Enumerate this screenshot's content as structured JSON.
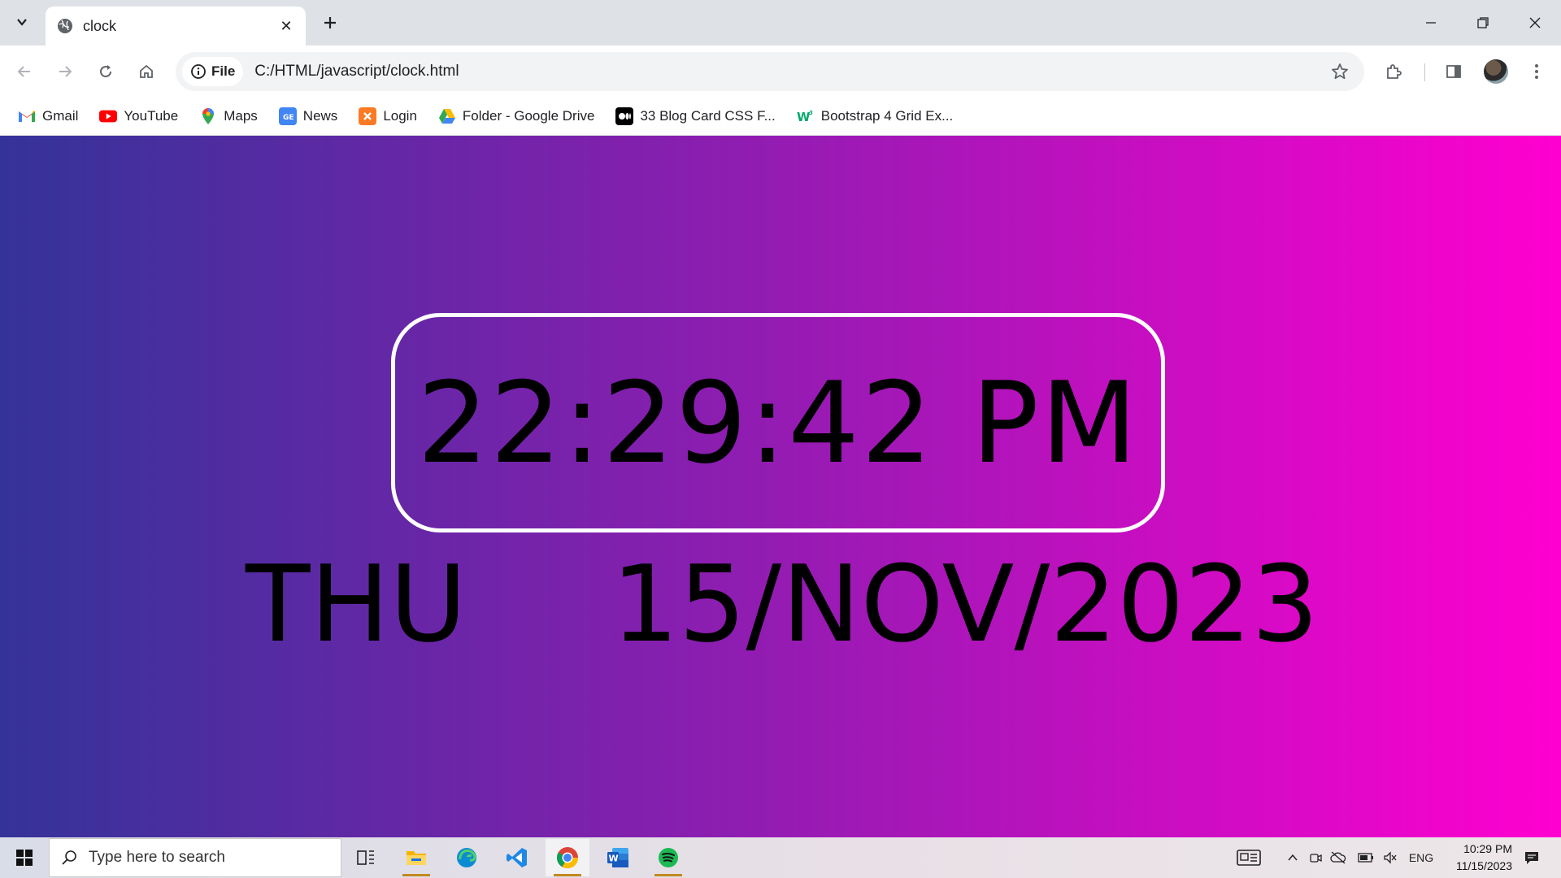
{
  "browser": {
    "tab": {
      "title": "clock"
    },
    "address": {
      "chip_label": "File",
      "url": "C:/HTML/javascript/clock.html"
    },
    "bookmarks": [
      {
        "label": "Gmail",
        "icon": "gmail-icon"
      },
      {
        "label": "YouTube",
        "icon": "youtube-icon"
      },
      {
        "label": "Maps",
        "icon": "maps-icon"
      },
      {
        "label": "News",
        "icon": "news-icon"
      },
      {
        "label": "Login",
        "icon": "xampp-icon"
      },
      {
        "label": "Folder - Google Drive",
        "icon": "google-drive-icon"
      },
      {
        "label": "33 Blog Card CSS F...",
        "icon": "medium-icon"
      },
      {
        "label": "Bootstrap 4 Grid Ex...",
        "icon": "w3schools-icon"
      }
    ]
  },
  "page": {
    "time": "22:29:42 PM",
    "day": "THU",
    "date": "15/NOV/2023",
    "colors": {
      "gradient_start": "#343399",
      "gradient_mid": "#8a1eb0",
      "gradient_end": "#ff00d0",
      "border": "#ffffff"
    }
  },
  "taskbar": {
    "search_placeholder": "Type here to search",
    "language": "ENG",
    "clock_time": "10:29 PM",
    "clock_date": "11/15/2023",
    "apps": [
      "task-view-icon",
      "file-explorer-icon",
      "edge-icon",
      "vscode-icon",
      "chrome-icon",
      "word-icon",
      "spotify-icon"
    ]
  }
}
